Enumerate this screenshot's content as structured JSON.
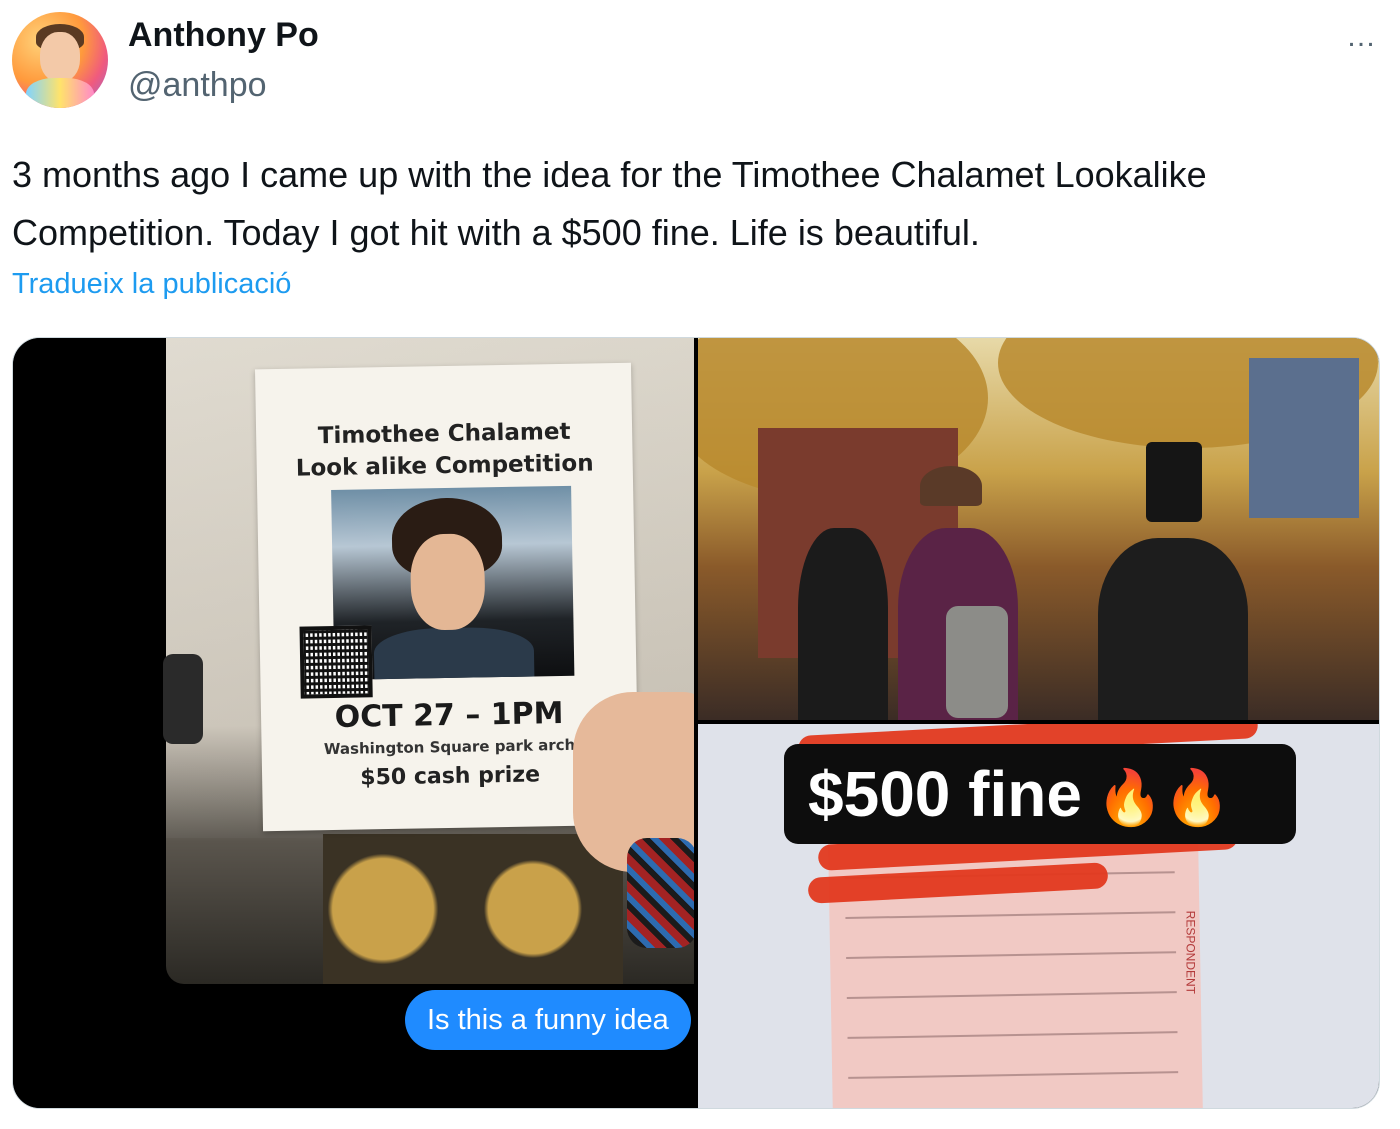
{
  "author": {
    "display_name": "Anthony Po",
    "handle": "@anthpo"
  },
  "more_icon": "…",
  "tweet": {
    "text": "3 months ago I came up with the idea for the Timothee Chalamet Lookalike Competition. Today I got hit with a $500 fine. Life is beautiful.",
    "translate_label": "Tradueix la publicació"
  },
  "media": {
    "image1": {
      "flyer_title_line1": "Timothee Chalamet",
      "flyer_title_line2": "Look alike Competition",
      "flyer_date": "OCT 27 – 1PM",
      "flyer_location": "Washington Square park arch",
      "flyer_prize": "$50 cash prize",
      "chat_bubble": "Is this a funny idea"
    },
    "image2": {
      "description_icon": "street-scene-photo"
    },
    "image3": {
      "overlay_text": "$500 fine",
      "overlay_emoji": "🔥🔥",
      "side_label": "RESPONDENT"
    }
  }
}
